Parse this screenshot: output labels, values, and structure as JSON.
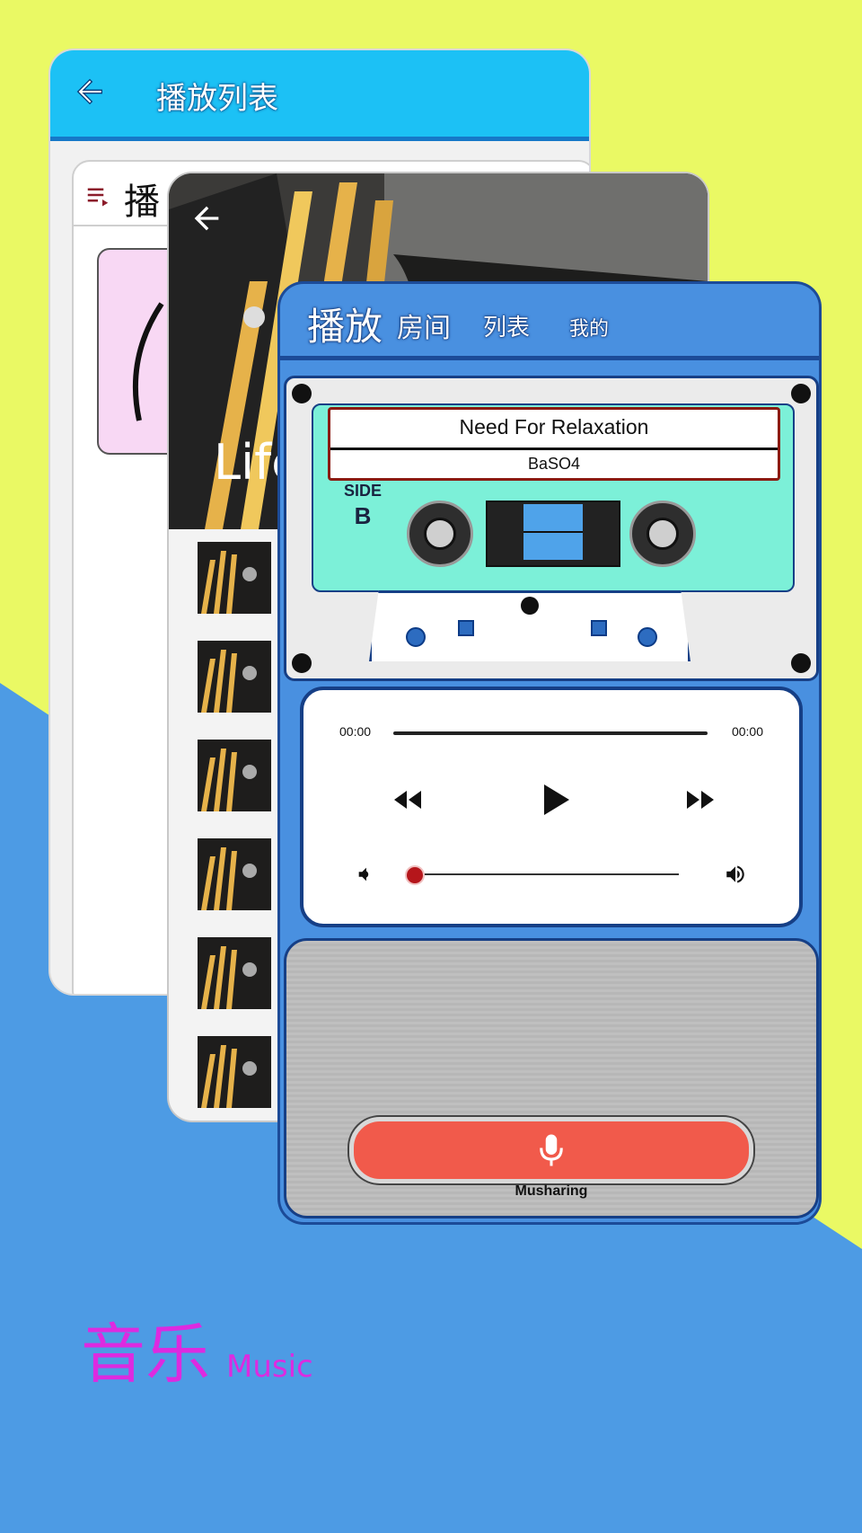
{
  "colors": {
    "background_yellow": "#eaf964",
    "background_blue": "#4d9be4",
    "header_cyan": "#1cc1f5",
    "player_blue": "#4990e0",
    "cassette_teal": "#7cf0d8",
    "mic_red": "#f15a4b",
    "caption_magenta": "#dd2ae0"
  },
  "playlist_card": {
    "title": "播放列表",
    "panel_title": "播",
    "back_icon": "back-arrow-icon",
    "menu_icon": "playlist-icon"
  },
  "room_card": {
    "hero_text": "Life",
    "back_icon": "back-arrow-icon",
    "track_count": 6
  },
  "player_card": {
    "tabs": [
      {
        "label": "播放"
      },
      {
        "label": "房间"
      },
      {
        "label": "列表"
      },
      {
        "label": "我的"
      }
    ],
    "cassette": {
      "song_title": "Need For Relaxation",
      "artist": "BaSO4",
      "side_label": "SIDE",
      "side_value": "B"
    },
    "playback": {
      "current_time": "00:00",
      "total_time": "00:00",
      "progress": 0,
      "volume": 0.03
    },
    "mic": {
      "icon": "microphone-icon",
      "brand": "Musharing"
    }
  },
  "caption": {
    "title": "音乐",
    "subtitle": "Music"
  }
}
